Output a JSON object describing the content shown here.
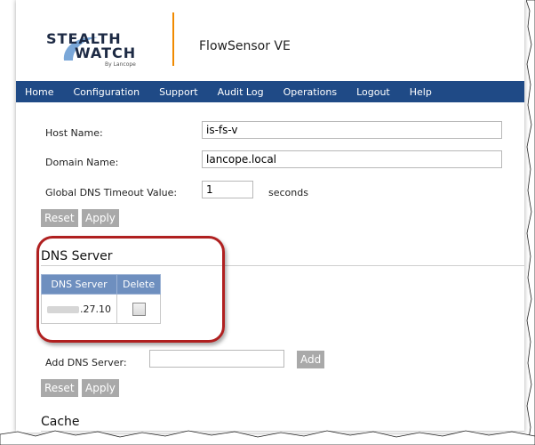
{
  "header": {
    "logo_line1": "STEALTH",
    "logo_line2": "WATCH",
    "logo_sub": "By Lancope",
    "product_name": "FlowSensor VE"
  },
  "nav": {
    "items": [
      "Home",
      "Configuration",
      "Support",
      "Audit Log",
      "Operations",
      "Logout",
      "Help"
    ]
  },
  "form": {
    "host_name_label": "Host Name:",
    "host_name_value": "is-fs-v",
    "domain_name_label": "Domain Name:",
    "domain_name_value": "lancope.local",
    "dns_timeout_label": "Global DNS Timeout Value:",
    "dns_timeout_value": "1",
    "dns_timeout_unit": "seconds",
    "reset_label": "Reset",
    "apply_label": "Apply"
  },
  "dns_section": {
    "title": "DNS Server",
    "columns": [
      "DNS Server",
      "Delete"
    ],
    "rows": [
      {
        "server_suffix": ".27.10",
        "delete_checked": false
      }
    ],
    "add_label": "Add DNS Server:",
    "add_value": "",
    "add_button": "Add",
    "reset_label": "Reset",
    "apply_label": "Apply"
  },
  "cache_section": {
    "title": "Cache"
  },
  "colors": {
    "nav_bg": "#1f4a86",
    "table_header_bg": "#6e8fbf",
    "button_bg": "#a9a9a9",
    "highlight": "#b02020",
    "accent_divider": "#f08a00"
  }
}
